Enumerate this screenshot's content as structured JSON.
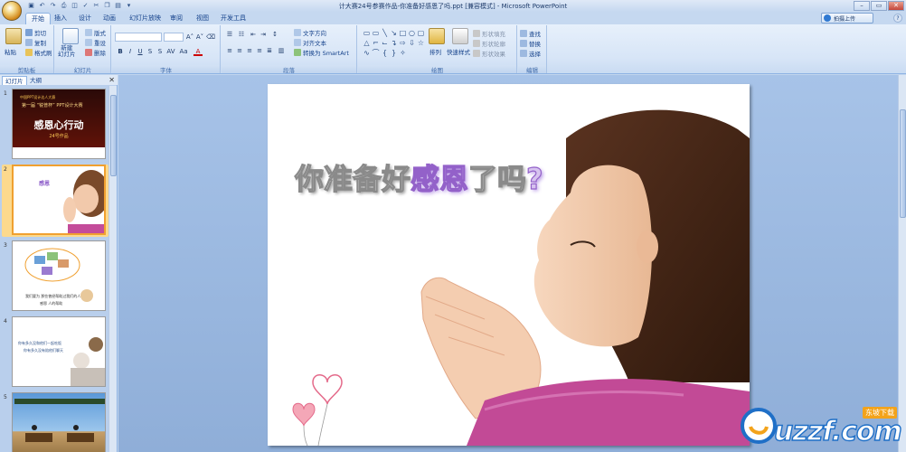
{
  "window": {
    "title": "计大赛24号参赛作品-你准备好感恩了吗.ppt [兼容模式] - Microsoft PowerPoint"
  },
  "tabs": [
    "开始",
    "插入",
    "设计",
    "动画",
    "幻灯片放映",
    "审阅",
    "视图",
    "开发工具"
  ],
  "upload_label": "拍摄上传",
  "ribbon": {
    "clipboard": {
      "paste": "粘贴",
      "cut": "剪切",
      "copy": "复制",
      "format_painter": "格式刷",
      "label": "剪贴板"
    },
    "slides": {
      "new_slide": "新建\n幻灯片",
      "layout": "版式",
      "reset": "重设",
      "delete": "删除",
      "label": "幻灯片"
    },
    "font": {
      "label": "字体"
    },
    "paragraph": {
      "text_direction": "文字方向",
      "align_text": "对齐文本",
      "smartart": "转换为 SmartArt",
      "label": "段落"
    },
    "drawing": {
      "arrange": "排列",
      "quick_styles": "快速样式",
      "shape_fill": "形状填充",
      "shape_outline": "形状轮廓",
      "shape_effects": "形状效果",
      "label": "绘图"
    },
    "editing": {
      "find": "查找",
      "replace": "替换",
      "select": "选择",
      "label": "编辑"
    }
  },
  "left_panel": {
    "tab_slides": "幻灯片",
    "tab_outline": "大纲",
    "thumbs": [
      {
        "num": "1",
        "line1": "中国PPT设计达人大赛",
        "line2": "第一届 “锐普杯” PPT设计大赛",
        "title": "感恩心行动",
        "sub": "24号作品"
      },
      {
        "num": "2",
        "title": "感恩"
      },
      {
        "num": "3",
        "line1": "我们要为 那些曾经帮助过我们的人",
        "line2": "感恩 人的帮助"
      },
      {
        "num": "4",
        "line1": "你有多久没和他们一起吃饭",
        "line2": "你有多久没有陪他们聊天"
      },
      {
        "num": "5"
      }
    ]
  },
  "slide": {
    "title_part1": "你准备好",
    "title_part2": "感恩",
    "title_part3": "了吗",
    "title_part4": "?"
  },
  "watermark": {
    "text": "uzzf.com",
    "cn": "东坡下载"
  }
}
